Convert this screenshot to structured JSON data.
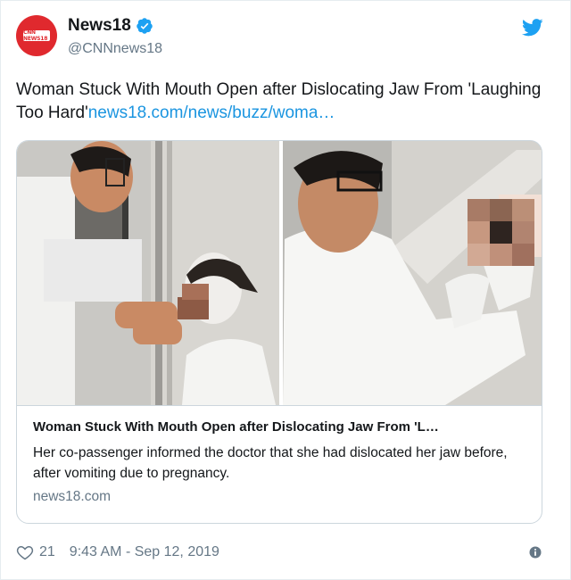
{
  "account": {
    "display_name": "News18",
    "handle": "@CNNnews18",
    "avatar_text": "CNN NEWS18"
  },
  "tweet": {
    "text": "Woman Stuck With Mouth Open after Dislocating Jaw From 'Laughing Too Hard'",
    "link_text": "news18.com/news/buzz/woma…"
  },
  "card": {
    "title": "Woman Stuck With Mouth Open after Dislocating Jaw From 'L…",
    "description": "Her co-passenger informed the doctor that she had dislocated her jaw before, after vomiting due to pregnancy.",
    "domain": "news18.com"
  },
  "footer": {
    "likes": "21",
    "timestamp": "9:43 AM - Sep 12, 2019"
  },
  "colors": {
    "link": "#1b95e0",
    "brand_red": "#e0292e",
    "twitter_blue": "#1da1f2",
    "muted": "#657786"
  },
  "icons": [
    "verified-badge-icon",
    "twitter-bird-icon",
    "heart-icon",
    "info-icon"
  ]
}
